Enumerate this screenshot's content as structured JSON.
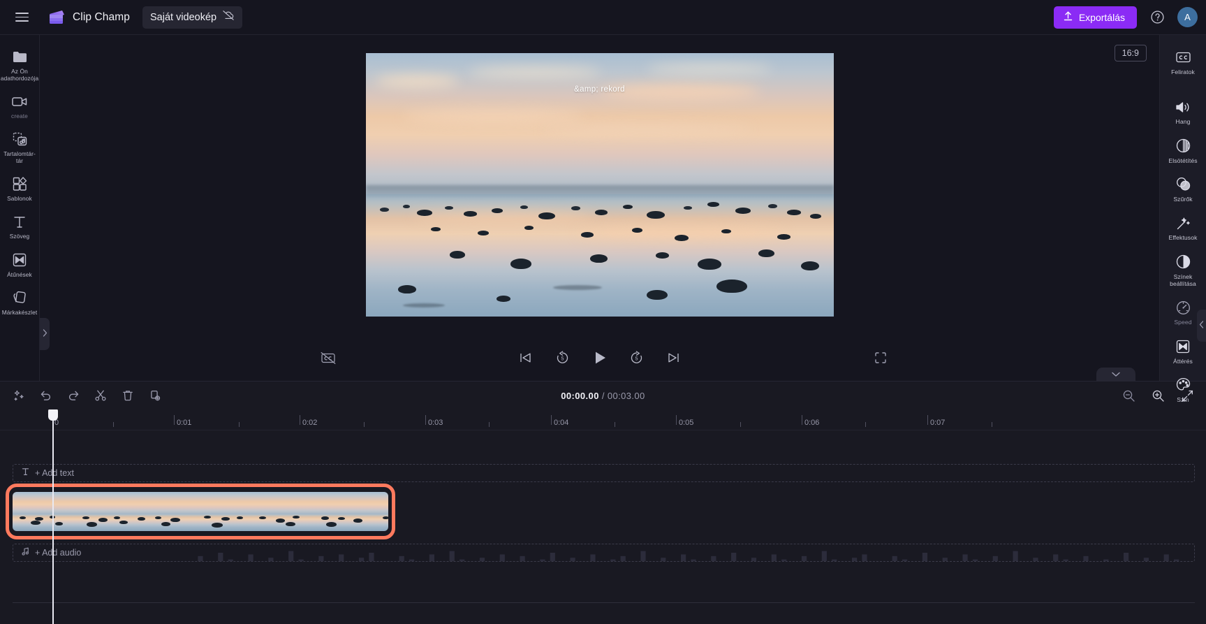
{
  "app": {
    "brand_name": "Clip Champ",
    "project_name": "Saját videokép",
    "menu_icon": "hamburger-icon",
    "logo_icon": "clipchamp-logo-icon",
    "cloud_off_icon": "cloud-off-icon"
  },
  "topbar": {
    "export_label": "Exportálás",
    "export_icon": "upload-icon",
    "help_icon": "help-circle-icon",
    "avatar_initial": "A",
    "accent_color": "#8b2bf5"
  },
  "left_rail": {
    "items": [
      {
        "label": "Az Ön adathordozója",
        "icon": "folder-icon",
        "dim": false
      },
      {
        "label": "create",
        "icon": "video-camera-icon",
        "dim": true
      },
      {
        "label": "Tartalomtár-tár",
        "icon": "content-library-icon",
        "dim": false
      },
      {
        "label": "Sablonok",
        "icon": "templates-icon",
        "dim": false
      },
      {
        "label": "Szöveg",
        "icon": "text-icon",
        "dim": false
      },
      {
        "label": "Átűnések",
        "icon": "transitions-icon",
        "dim": false
      },
      {
        "label": "Márkakészlet",
        "icon": "brand-kit-icon",
        "dim": false
      }
    ],
    "collapse_icon": "chevron-right-icon"
  },
  "right_rail": {
    "items": [
      {
        "label": "Feliratok",
        "icon": "closed-captions-icon",
        "dim": false
      },
      {
        "label": "Hang",
        "icon": "speaker-icon",
        "dim": false
      },
      {
        "label": "Elsötétítés",
        "icon": "fade-icon",
        "dim": false
      },
      {
        "label": "Szűrők",
        "icon": "filters-icon",
        "dim": false
      },
      {
        "label": "Effektusok",
        "icon": "effects-wand-icon",
        "dim": false
      },
      {
        "label": "Színek beállítása",
        "icon": "adjust-colors-icon",
        "dim": false
      },
      {
        "label": "Speed",
        "icon": "speedometer-icon",
        "dim": true
      },
      {
        "label": "Áttérés",
        "icon": "transitions-icon",
        "dim": false
      },
      {
        "label": "Szín",
        "icon": "palette-icon",
        "dim": false
      }
    ],
    "collapse_icon": "chevron-left-icon"
  },
  "preview": {
    "aspect_ratio": "16:9",
    "overlay_text": "&amp; rekord",
    "collapse_icon": "chevron-down-icon",
    "cc_off_icon": "closed-captions-off-icon",
    "fullscreen_icon": "fullscreen-icon",
    "transport": [
      {
        "name": "skip-to-start-button",
        "icon": "skip-previous-icon"
      },
      {
        "name": "rewind-5s-button",
        "icon": "rewind-5-icon"
      },
      {
        "name": "play-button",
        "icon": "play-icon"
      },
      {
        "name": "forward-5s-button",
        "icon": "forward-5-icon"
      },
      {
        "name": "skip-to-end-button",
        "icon": "skip-next-icon"
      }
    ]
  },
  "timeline": {
    "current_time": "00:00.00",
    "separator": " / ",
    "total_time": "00:03.00",
    "tools": [
      {
        "name": "magic-suggestion-button",
        "icon": "sparkle-icon"
      },
      {
        "name": "undo-button",
        "icon": "undo-icon"
      },
      {
        "name": "redo-button",
        "icon": "redo-icon"
      },
      {
        "name": "split-button",
        "icon": "scissors-icon"
      },
      {
        "name": "delete-button",
        "icon": "trash-icon"
      },
      {
        "name": "duplicate-button",
        "icon": "duplicate-icon"
      }
    ],
    "zoom_tools": [
      {
        "name": "zoom-out-button",
        "icon": "zoom-out-icon"
      },
      {
        "name": "zoom-in-button",
        "icon": "zoom-in-icon"
      },
      {
        "name": "fit-to-timeline-button",
        "icon": "fit-icon"
      }
    ],
    "ruler_labels": [
      "0",
      "0:01",
      "0:02",
      "0:03",
      "0:04",
      "0:05",
      "0:06",
      "0:07"
    ],
    "text_track_label": "+ Add text",
    "text_track_icon": "text-T-icon",
    "audio_track_label": "+ Add audio",
    "audio_track_icon": "music-note-icon",
    "selection_color": "#ff7a5e"
  }
}
